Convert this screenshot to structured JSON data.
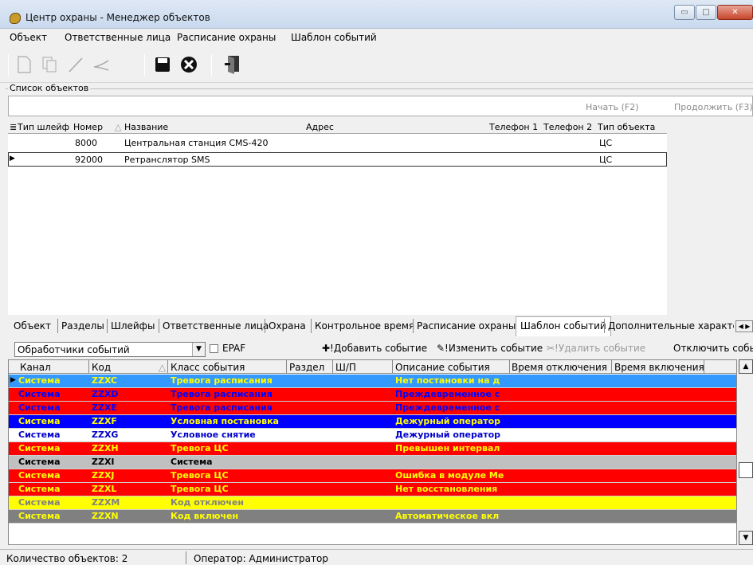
{
  "window": {
    "title": "Центр охраны - Менеджер объектов",
    "min": "▭",
    "max": "□",
    "close": "✕"
  },
  "menu": [
    "Объект",
    "Ответственные лица",
    "Расписание охраны",
    "Шаблон событий"
  ],
  "toolbar_icons": [
    "new-icon",
    "copy-icon",
    "edit-icon",
    "cut-icon",
    "save-icon",
    "cancel-icon",
    "exit-icon"
  ],
  "objects_group": {
    "label": "Список объектов",
    "search_value": "",
    "start_label": "Начать (F2)",
    "continue_label": "Продолжить (F3)"
  },
  "objects_table": {
    "columns": [
      "Тип шлейф",
      "Номер",
      "Название",
      "Адрес",
      "Телефон 1",
      "Телефон 2",
      "Тип объекта"
    ],
    "rows": [
      {
        "type": "",
        "number": "8000",
        "name": "Центральная станция CMS-420",
        "address": "",
        "phone1": "",
        "phone2": "",
        "obj_type": "ЦС"
      },
      {
        "type": "",
        "number": "92000",
        "name": "Ретранслятор SMS",
        "address": "",
        "phone1": "",
        "phone2": "",
        "obj_type": "ЦС"
      }
    ]
  },
  "tabs": [
    "Объект",
    "Разделы",
    "Шлейфы",
    "Ответственные лица",
    "Охрана",
    "Контрольное время",
    "Расписание охраны",
    "Шаблон событий",
    "Дополнительные характе"
  ],
  "active_tab": "Шаблон событий",
  "events_toolbar": {
    "handler_value": "Обработчики событий",
    "epaf_label": "EPAF",
    "epaf_checked": false,
    "add_label": "Добавить событие",
    "edit_label": "Изменить событие",
    "delete_label": "Удалить событие",
    "disable_label": "Отключить событ"
  },
  "events_table": {
    "columns": [
      "Канал",
      "Код",
      "Класс события",
      "Раздел",
      "Ш/П",
      "Описание события",
      "Время отключения",
      "Время включения"
    ],
    "rows": [
      {
        "channel": "Система",
        "code": "ZZXC",
        "class": "Тревога расписания",
        "desc": "Нет постановки на д",
        "bg": "#3399ff",
        "fg": "#ffff00"
      },
      {
        "channel": "Система",
        "code": "ZZXD",
        "class": "Тревога расписания",
        "desc": "Преждевременное с",
        "bg": "#ff0000",
        "fg": "#0000ff"
      },
      {
        "channel": "Система",
        "code": "ZZXE",
        "class": "Тревога расписания",
        "desc": "Преждевременное с",
        "bg": "#ff0000",
        "fg": "#0000ff"
      },
      {
        "channel": "Система",
        "code": "ZZXF",
        "class": "Условная постановка",
        "desc": "Дежурный оператор",
        "bg": "#0000ff",
        "fg": "#ffff00"
      },
      {
        "channel": "Система",
        "code": "ZZXG",
        "class": "Условное снятие",
        "desc": "Дежурный оператор",
        "bg": "#ffffff",
        "fg": "#0000cc"
      },
      {
        "channel": "Система",
        "code": "ZZXH",
        "class": "Тревога ЦС",
        "desc": "Превышен интервал",
        "bg": "#ff0000",
        "fg": "#ffff00"
      },
      {
        "channel": "Система",
        "code": "ZZXI",
        "class": "Система",
        "desc": "",
        "bg": "#c0c0c0",
        "fg": "#000000"
      },
      {
        "channel": "Система",
        "code": "ZZXJ",
        "class": "Тревога ЦС",
        "desc": "Ошибка в модуле Ме",
        "bg": "#ff0000",
        "fg": "#ffff00"
      },
      {
        "channel": "Система",
        "code": "ZZXL",
        "class": "Тревога ЦС",
        "desc": "Нет восстановления",
        "bg": "#ff0000",
        "fg": "#ffff00"
      },
      {
        "channel": "Система",
        "code": "ZZXM",
        "class": "Код отключен",
        "desc": "",
        "bg": "#ffff00",
        "fg": "#808080"
      },
      {
        "channel": "Система",
        "code": "ZZXN",
        "class": "Код включен",
        "desc": "Автоматическое вкл",
        "bg": "#808080",
        "fg": "#ffff00"
      }
    ]
  },
  "status": {
    "count": "Количество объектов: 2",
    "operator": "Оператор: Администратор"
  }
}
